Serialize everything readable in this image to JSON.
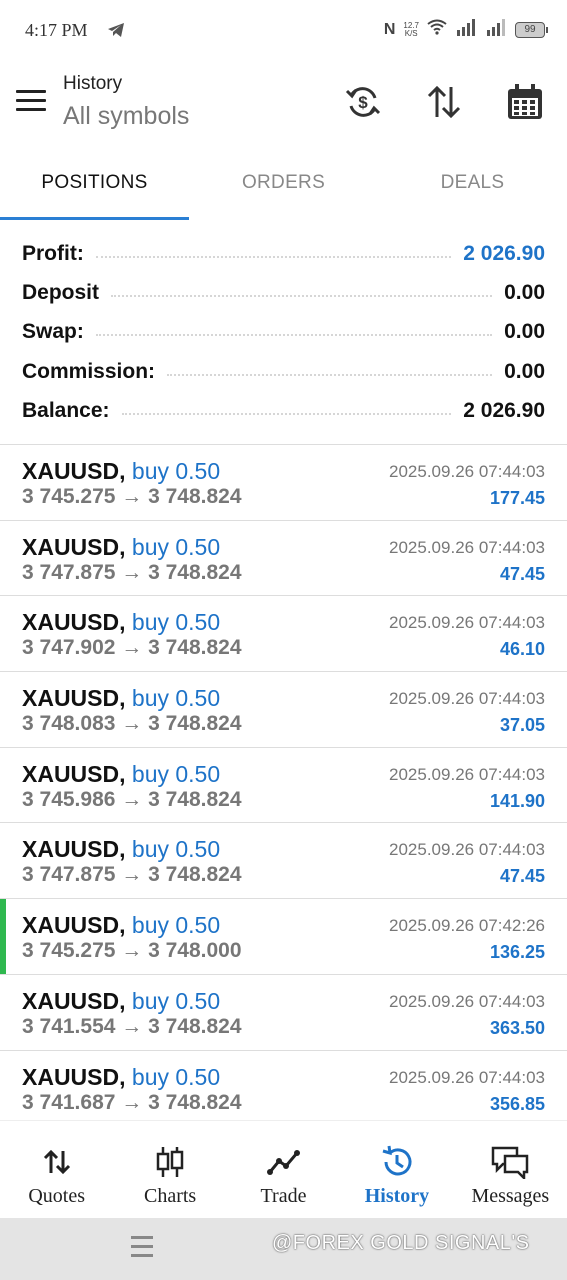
{
  "status_bar": {
    "time": "4:17 PM",
    "nfc": "N",
    "speed_value": "12.7",
    "speed_unit": "K/S",
    "battery": "99"
  },
  "app_bar": {
    "title": "History",
    "subtitle": "All symbols"
  },
  "tabs": [
    {
      "label": "POSITIONS",
      "active": true
    },
    {
      "label": "ORDERS",
      "active": false
    },
    {
      "label": "DEALS",
      "active": false
    }
  ],
  "summary": {
    "profit_label": "Profit:",
    "profit": "2 026.90",
    "deposit_label": "Deposit",
    "deposit": "0.00",
    "swap_label": "Swap:",
    "swap": "0.00",
    "commission_label": "Commission:",
    "commission": "0.00",
    "balance_label": "Balance:",
    "balance": "2 026.90"
  },
  "trades": [
    {
      "symbol": "XAUUSD,",
      "side": "buy 0.50",
      "open": "3 745.275",
      "close": "3 748.824",
      "time": "2025.09.26 07:44:03",
      "profit": "177.45",
      "highlight": false
    },
    {
      "symbol": "XAUUSD,",
      "side": "buy 0.50",
      "open": "3 747.875",
      "close": "3 748.824",
      "time": "2025.09.26 07:44:03",
      "profit": "47.45",
      "highlight": false
    },
    {
      "symbol": "XAUUSD,",
      "side": "buy 0.50",
      "open": "3 747.902",
      "close": "3 748.824",
      "time": "2025.09.26 07:44:03",
      "profit": "46.10",
      "highlight": false
    },
    {
      "symbol": "XAUUSD,",
      "side": "buy 0.50",
      "open": "3 748.083",
      "close": "3 748.824",
      "time": "2025.09.26 07:44:03",
      "profit": "37.05",
      "highlight": false
    },
    {
      "symbol": "XAUUSD,",
      "side": "buy 0.50",
      "open": "3 745.986",
      "close": "3 748.824",
      "time": "2025.09.26 07:44:03",
      "profit": "141.90",
      "highlight": false
    },
    {
      "symbol": "XAUUSD,",
      "side": "buy 0.50",
      "open": "3 747.875",
      "close": "3 748.824",
      "time": "2025.09.26 07:44:03",
      "profit": "47.45",
      "highlight": false
    },
    {
      "symbol": "XAUUSD,",
      "side": "buy 0.50",
      "open": "3 745.275",
      "close": "3 748.000",
      "time": "2025.09.26 07:42:26",
      "profit": "136.25",
      "highlight": true
    },
    {
      "symbol": "XAUUSD,",
      "side": "buy 0.50",
      "open": "3 741.554",
      "close": "3 748.824",
      "time": "2025.09.26 07:44:03",
      "profit": "363.50",
      "highlight": false
    },
    {
      "symbol": "XAUUSD,",
      "side": "buy 0.50",
      "open": "3 741.687",
      "close": "3 748.824",
      "time": "2025.09.26 07:44:03",
      "profit": "356.85",
      "highlight": false
    }
  ],
  "bottom_nav": [
    {
      "label": "Quotes",
      "icon": "quotes-icon",
      "active": false
    },
    {
      "label": "Charts",
      "icon": "charts-icon",
      "active": false
    },
    {
      "label": "Trade",
      "icon": "trade-icon",
      "active": false
    },
    {
      "label": "History",
      "icon": "history-icon",
      "active": true
    },
    {
      "label": "Messages",
      "icon": "messages-icon",
      "active": false
    }
  ],
  "watermark": "@FOREX GOLD SIGNAL'S",
  "colors": {
    "accent": "#1e73c8",
    "tab_indicator": "#2a7fd4",
    "highlight_marker": "#2fb84f"
  }
}
